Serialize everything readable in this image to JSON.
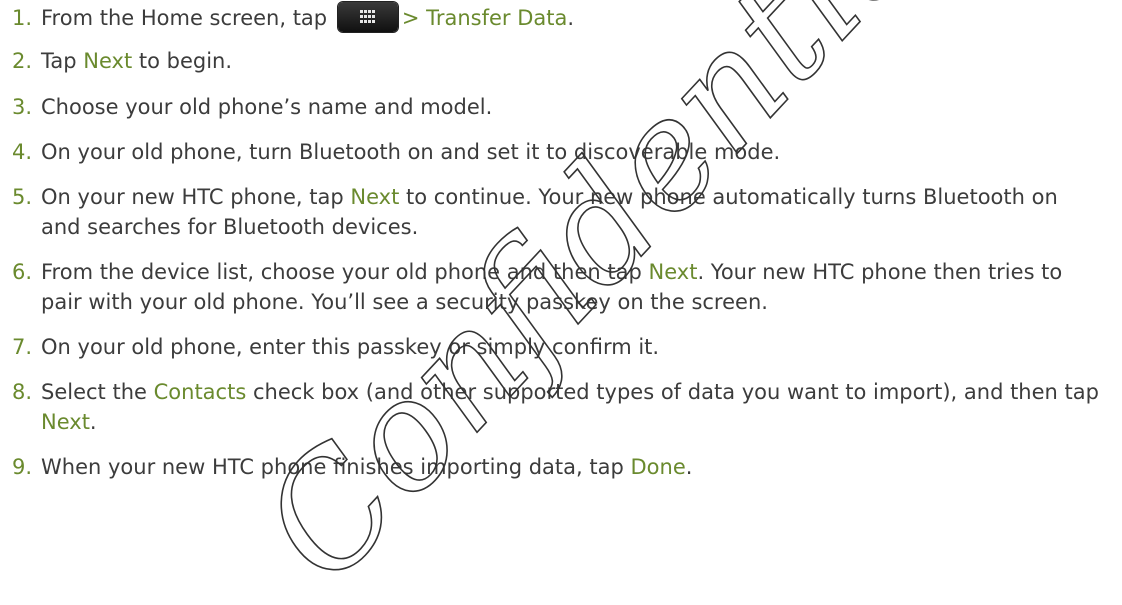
{
  "steps": [
    {
      "num": "1.",
      "before": "From the Home screen, tap",
      "after": "> Transfer Data",
      "tail": "."
    },
    {
      "num": "2.",
      "t1": "Tap",
      "b1": "Next",
      "t2": "to begin."
    },
    {
      "num": "3.",
      "t1": "Choose your old phone’s name and model."
    },
    {
      "num": "4.",
      "t1": "On your old phone, turn Bluetooth on and set it to discoverable mode."
    },
    {
      "num": "5.",
      "t1": "On your new HTC phone, tap",
      "b1": "Next",
      "t2": "to continue. Your new phone automatically turns Bluetooth on and searches for Bluetooth devices."
    },
    {
      "num": "6.",
      "t1": "From the device list, choose your old phone and then tap",
      "b1": "Next",
      "t2": ". Your new HTC phone then tries to pair with your old phone. You’ll see a security passkey on the screen."
    },
    {
      "num": "7.",
      "t1": "On your old phone, enter this passkey or simply confirm it."
    },
    {
      "num": "8.",
      "t1": "Select the",
      "b1": "Contacts",
      "t2": "check box (and other supported types of data you want to import), and then tap",
      "b2": "Next",
      "t3": "."
    },
    {
      "num": "9.",
      "t1": "When your new HTC phone finishes importing data, tap",
      "b1": "Done",
      "t2": "."
    }
  ],
  "watermark": {
    "text": "Confidential",
    "color": "#333333"
  },
  "icons": {
    "apps": "apps-grid-icon"
  },
  "colors": {
    "accent": "#6a8a2e",
    "text": "#3c3c3c"
  }
}
